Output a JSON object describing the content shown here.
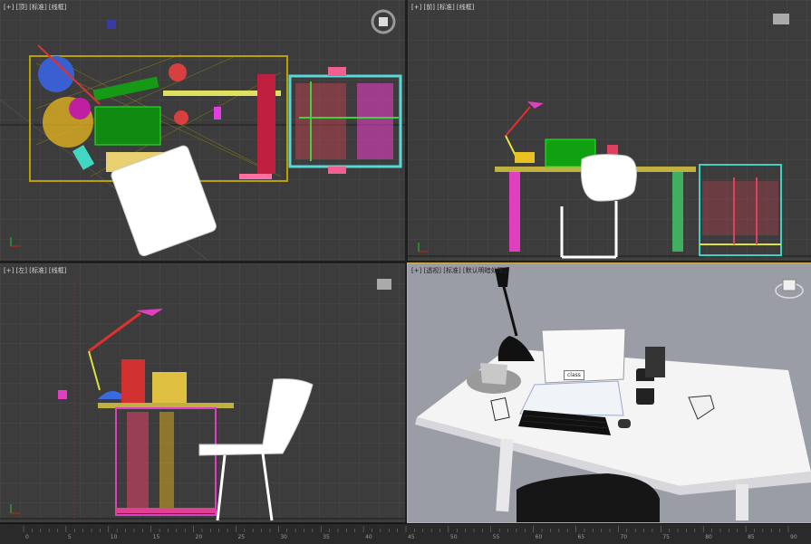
{
  "viewports": {
    "top": {
      "label": "[+] [顶] [标准] [线框]"
    },
    "front": {
      "label": "[+] [前] [标准] [线框]"
    },
    "left": {
      "label": "[+] [左] [标准] [线框]"
    },
    "perspective": {
      "label": "[+] [透视] [标准] [默认明暗处理]",
      "note": "class"
    }
  },
  "timeline": {
    "ticks": [
      "0",
      "5",
      "10",
      "15",
      "20",
      "25",
      "30",
      "35",
      "40",
      "45",
      "50",
      "55",
      "60",
      "65",
      "70",
      "75",
      "80",
      "85",
      "90"
    ]
  },
  "colors": {
    "viewport_bg": "#3c3c3c",
    "grid": "#4a4a4a",
    "active_border": "#d4b04a",
    "persp_bg": "#9a9ca6"
  }
}
